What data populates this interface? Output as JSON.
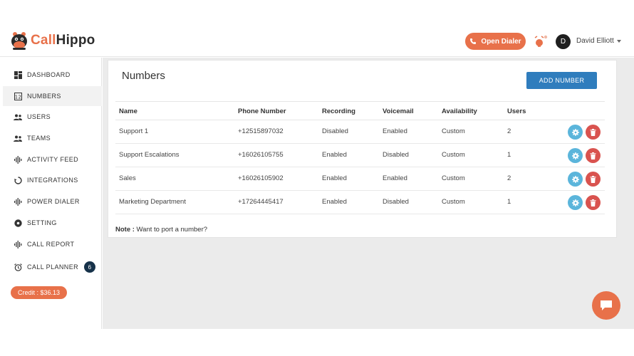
{
  "brand": {
    "part1": "Call",
    "part2": "Hippo"
  },
  "header": {
    "open_dialer_label": "Open Dialer",
    "avatar_initial": "D",
    "user_name": "David Elliott"
  },
  "sidebar": {
    "items": [
      {
        "label": "DASHBOARD",
        "icon": "dashboard-icon"
      },
      {
        "label": "NUMBERS",
        "icon": "numbers-icon"
      },
      {
        "label": "USERS",
        "icon": "users-icon"
      },
      {
        "label": "TEAMS",
        "icon": "teams-icon"
      },
      {
        "label": "ACTIVITY FEED",
        "icon": "activity-icon"
      },
      {
        "label": "INTEGRATIONS",
        "icon": "integrations-icon"
      },
      {
        "label": "POWER DIALER",
        "icon": "power-dialer-icon"
      },
      {
        "label": "SETTING",
        "icon": "setting-icon"
      },
      {
        "label": "CALL REPORT",
        "icon": "call-report-icon"
      },
      {
        "label": "CALL PLANNER",
        "icon": "alarm-clock-icon",
        "badge": "6"
      }
    ],
    "credit": "Credit : $36.13"
  },
  "main": {
    "title": "Numbers",
    "add_button": "ADD NUMBER",
    "columns": [
      "Name",
      "Phone Number",
      "Recording",
      "Voicemail",
      "Availability",
      "Users"
    ],
    "rows": [
      [
        "Support 1",
        "+12515897032",
        "Disabled",
        "Enabled",
        "Custom",
        "2"
      ],
      [
        "Support Escalations",
        "+16026105755",
        "Enabled",
        "Disabled",
        "Custom",
        "1"
      ],
      [
        "Sales",
        "+16026105902",
        "Enabled",
        "Enabled",
        "Custom",
        "2"
      ],
      [
        "Marketing Department",
        "+17264445417",
        "Enabled",
        "Disabled",
        "Custom",
        "1"
      ]
    ],
    "note_label": "Note :",
    "note_text": " Want to port a number?"
  },
  "colors": {
    "accent": "#e8714a",
    "primary": "#2f7dbd",
    "edit": "#5bb5db",
    "delete": "#d9534f"
  }
}
